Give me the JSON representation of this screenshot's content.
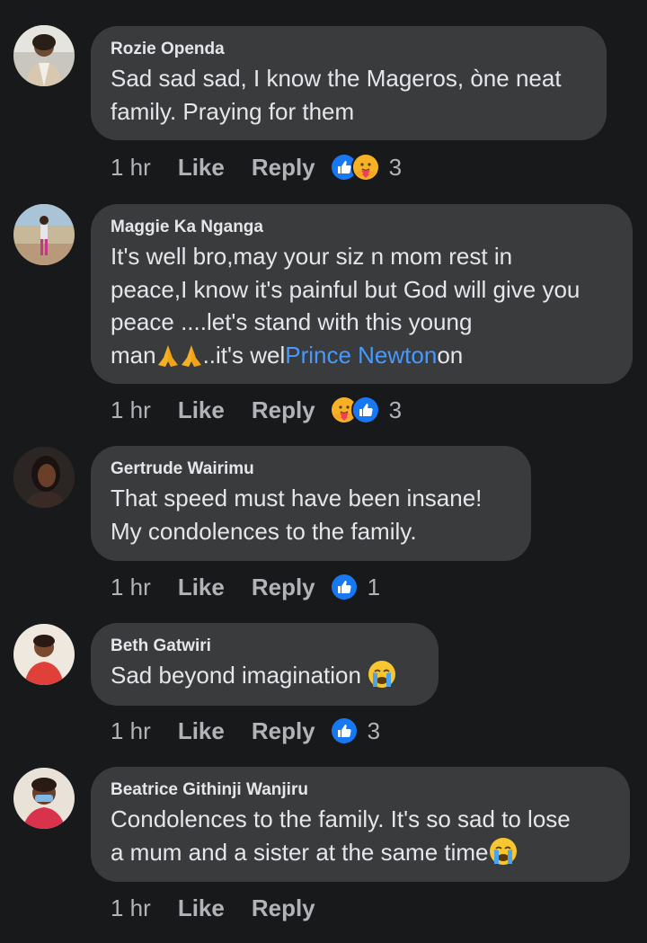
{
  "comments": [
    {
      "author": "Rozie Openda",
      "lines": [
        "Sad sad sad, I know the Mageros, òne neat",
        "family. Praying for them"
      ],
      "time": "1 hr",
      "like_label": "Like",
      "reply_label": "Reply",
      "reactions": [
        "like-reaction-icon",
        "care-reaction-icon"
      ],
      "reaction_count": "3"
    },
    {
      "author": "Maggie Ka Nganga",
      "lines": [
        "It's well bro,may your siz n mom rest in",
        "peace,I know it's painful but God will give you",
        "peace ....let's stand with this young"
      ],
      "line4_pre": "man",
      "line4_mid": "..it's wel",
      "line4_link": "Prince Newton",
      "line4_post": "on",
      "time": "1 hr",
      "like_label": "Like",
      "reply_label": "Reply",
      "reactions": [
        "care-reaction-icon",
        "like-reaction-icon"
      ],
      "reaction_count": "3"
    },
    {
      "author": "Gertrude Wairimu",
      "lines": [
        "That speed must have been insane!",
        "My condolences to the family."
      ],
      "time": "1 hr",
      "like_label": "Like",
      "reply_label": "Reply",
      "reactions": [
        "like-reaction-icon"
      ],
      "reaction_count": "1"
    },
    {
      "author": "Beth Gatwiri",
      "lines": [
        "Sad beyond imagination"
      ],
      "time": "1 hr",
      "like_label": "Like",
      "reply_label": "Reply",
      "reactions": [
        "like-reaction-icon"
      ],
      "reaction_count": "3"
    },
    {
      "author": "Beatrice Githinji Wanjiru",
      "lines": [
        "Condolences to the family. It's so sad to lose",
        "a mum and a sister at the same time"
      ],
      "time": "1 hr",
      "like_label": "Like",
      "reply_label": "Reply"
    }
  ],
  "colors": {
    "background": "#18191a",
    "bubble": "#3a3b3c",
    "text": "#e4e6eb",
    "secondary_text": "#b0b3b8",
    "link": "#4599ff",
    "like_blue": "#1877f2"
  }
}
